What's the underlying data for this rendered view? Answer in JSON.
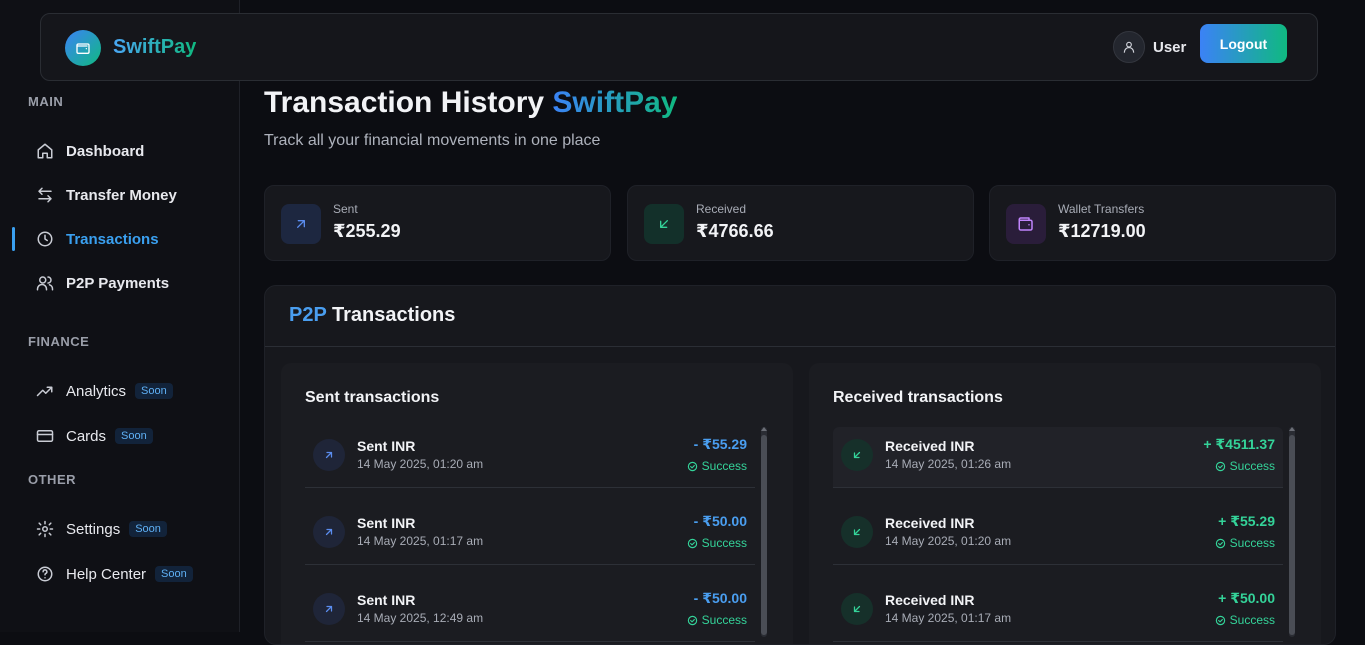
{
  "brand": {
    "name": "SwiftPay"
  },
  "header": {
    "user_label": "User",
    "logout_label": "Logout"
  },
  "sidebar": {
    "sections": [
      {
        "title": "MAIN"
      },
      {
        "title": "FINANCE"
      },
      {
        "title": "OTHER"
      }
    ],
    "items": [
      {
        "label": "Dashboard",
        "icon": "home-icon"
      },
      {
        "label": "Transfer Money",
        "icon": "transfer-icon"
      },
      {
        "label": "Transactions",
        "icon": "clock-icon",
        "active": true
      },
      {
        "label": "P2P Payments",
        "icon": "users-icon"
      },
      {
        "label": "Analytics",
        "icon": "trending-up-icon",
        "badge": "Soon"
      },
      {
        "label": "Cards",
        "icon": "credit-card-icon",
        "badge": "Soon"
      },
      {
        "label": "Settings",
        "icon": "gear-icon",
        "badge": "Soon"
      },
      {
        "label": "Help Center",
        "icon": "help-icon",
        "badge": "Soon"
      }
    ]
  },
  "page": {
    "title_main": "Transaction History",
    "title_accent": "SwiftPay",
    "subtitle": "Track all your financial movements in one place"
  },
  "stats": [
    {
      "label": "Sent",
      "value": "₹255.29",
      "icon": "arrow-up-right-icon",
      "color": "#5b8def"
    },
    {
      "label": "Received",
      "value": "₹4766.66",
      "icon": "arrow-down-left-icon",
      "color": "#34d399"
    },
    {
      "label": "Wallet Transfers",
      "value": "₹12719.00",
      "icon": "wallet-icon",
      "color": "#c084fc"
    }
  ],
  "p2p": {
    "title_accent": "P2P",
    "title_rest": "Transactions",
    "sent": {
      "title": "Sent transactions",
      "rows": [
        {
          "title": "Sent INR",
          "date": "14 May 2025, 01:20 am",
          "amount": "- ₹55.29",
          "status": "Success"
        },
        {
          "title": "Sent INR",
          "date": "14 May 2025, 01:17 am",
          "amount": "- ₹50.00",
          "status": "Success"
        },
        {
          "title": "Sent INR",
          "date": "14 May 2025, 12:49 am",
          "amount": "- ₹50.00",
          "status": "Success"
        }
      ]
    },
    "received": {
      "title": "Received transactions",
      "rows": [
        {
          "title": "Received INR",
          "date": "14 May 2025, 01:26 am",
          "amount": "+ ₹4511.37",
          "status": "Success"
        },
        {
          "title": "Received INR",
          "date": "14 May 2025, 01:20 am",
          "amount": "+ ₹55.29",
          "status": "Success"
        },
        {
          "title": "Received INR",
          "date": "14 May 2025, 01:17 am",
          "amount": "+ ₹50.00",
          "status": "Success"
        }
      ]
    }
  },
  "colors": {
    "accent_blue": "#3b82f6",
    "accent_green": "#10b981",
    "background": "#0c0d12"
  }
}
